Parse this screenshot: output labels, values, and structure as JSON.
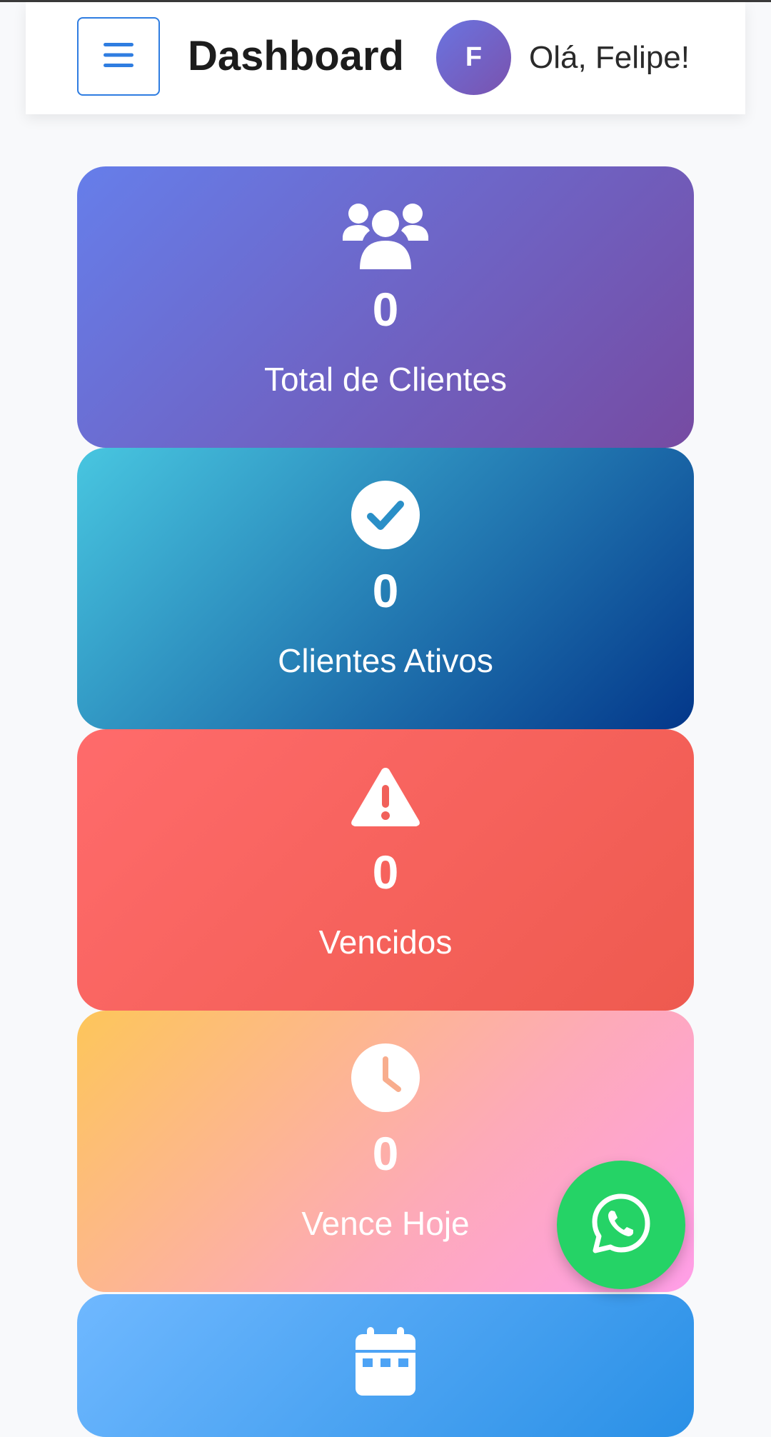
{
  "header": {
    "title": "Dashboard",
    "avatar_initial": "F",
    "greeting": "Olá, Felipe!"
  },
  "cards": [
    {
      "icon": "users-icon",
      "value": "0",
      "label": "Total de Clientes"
    },
    {
      "icon": "check-circle-icon",
      "value": "0",
      "label": "Clientes Ativos"
    },
    {
      "icon": "warning-triangle-icon",
      "value": "0",
      "label": "Vencidos"
    },
    {
      "icon": "clock-icon",
      "value": "0",
      "label": "Vence Hoje"
    },
    {
      "icon": "calendar-icon"
    }
  ],
  "fab": {
    "icon": "whatsapp-icon"
  },
  "colors": {
    "menu_accent": "#2f7de1",
    "card_total": [
      "#667eea",
      "#764ba2"
    ],
    "card_active": [
      "#48c6e0",
      "#03378a"
    ],
    "card_overdue": [
      "#ff6b6b",
      "#ee5a4f"
    ],
    "card_today": [
      "#fdc65a",
      "#ff9ee8"
    ],
    "card_next": [
      "#6fb8ff",
      "#2a90e6"
    ],
    "whatsapp": "#25d366"
  }
}
